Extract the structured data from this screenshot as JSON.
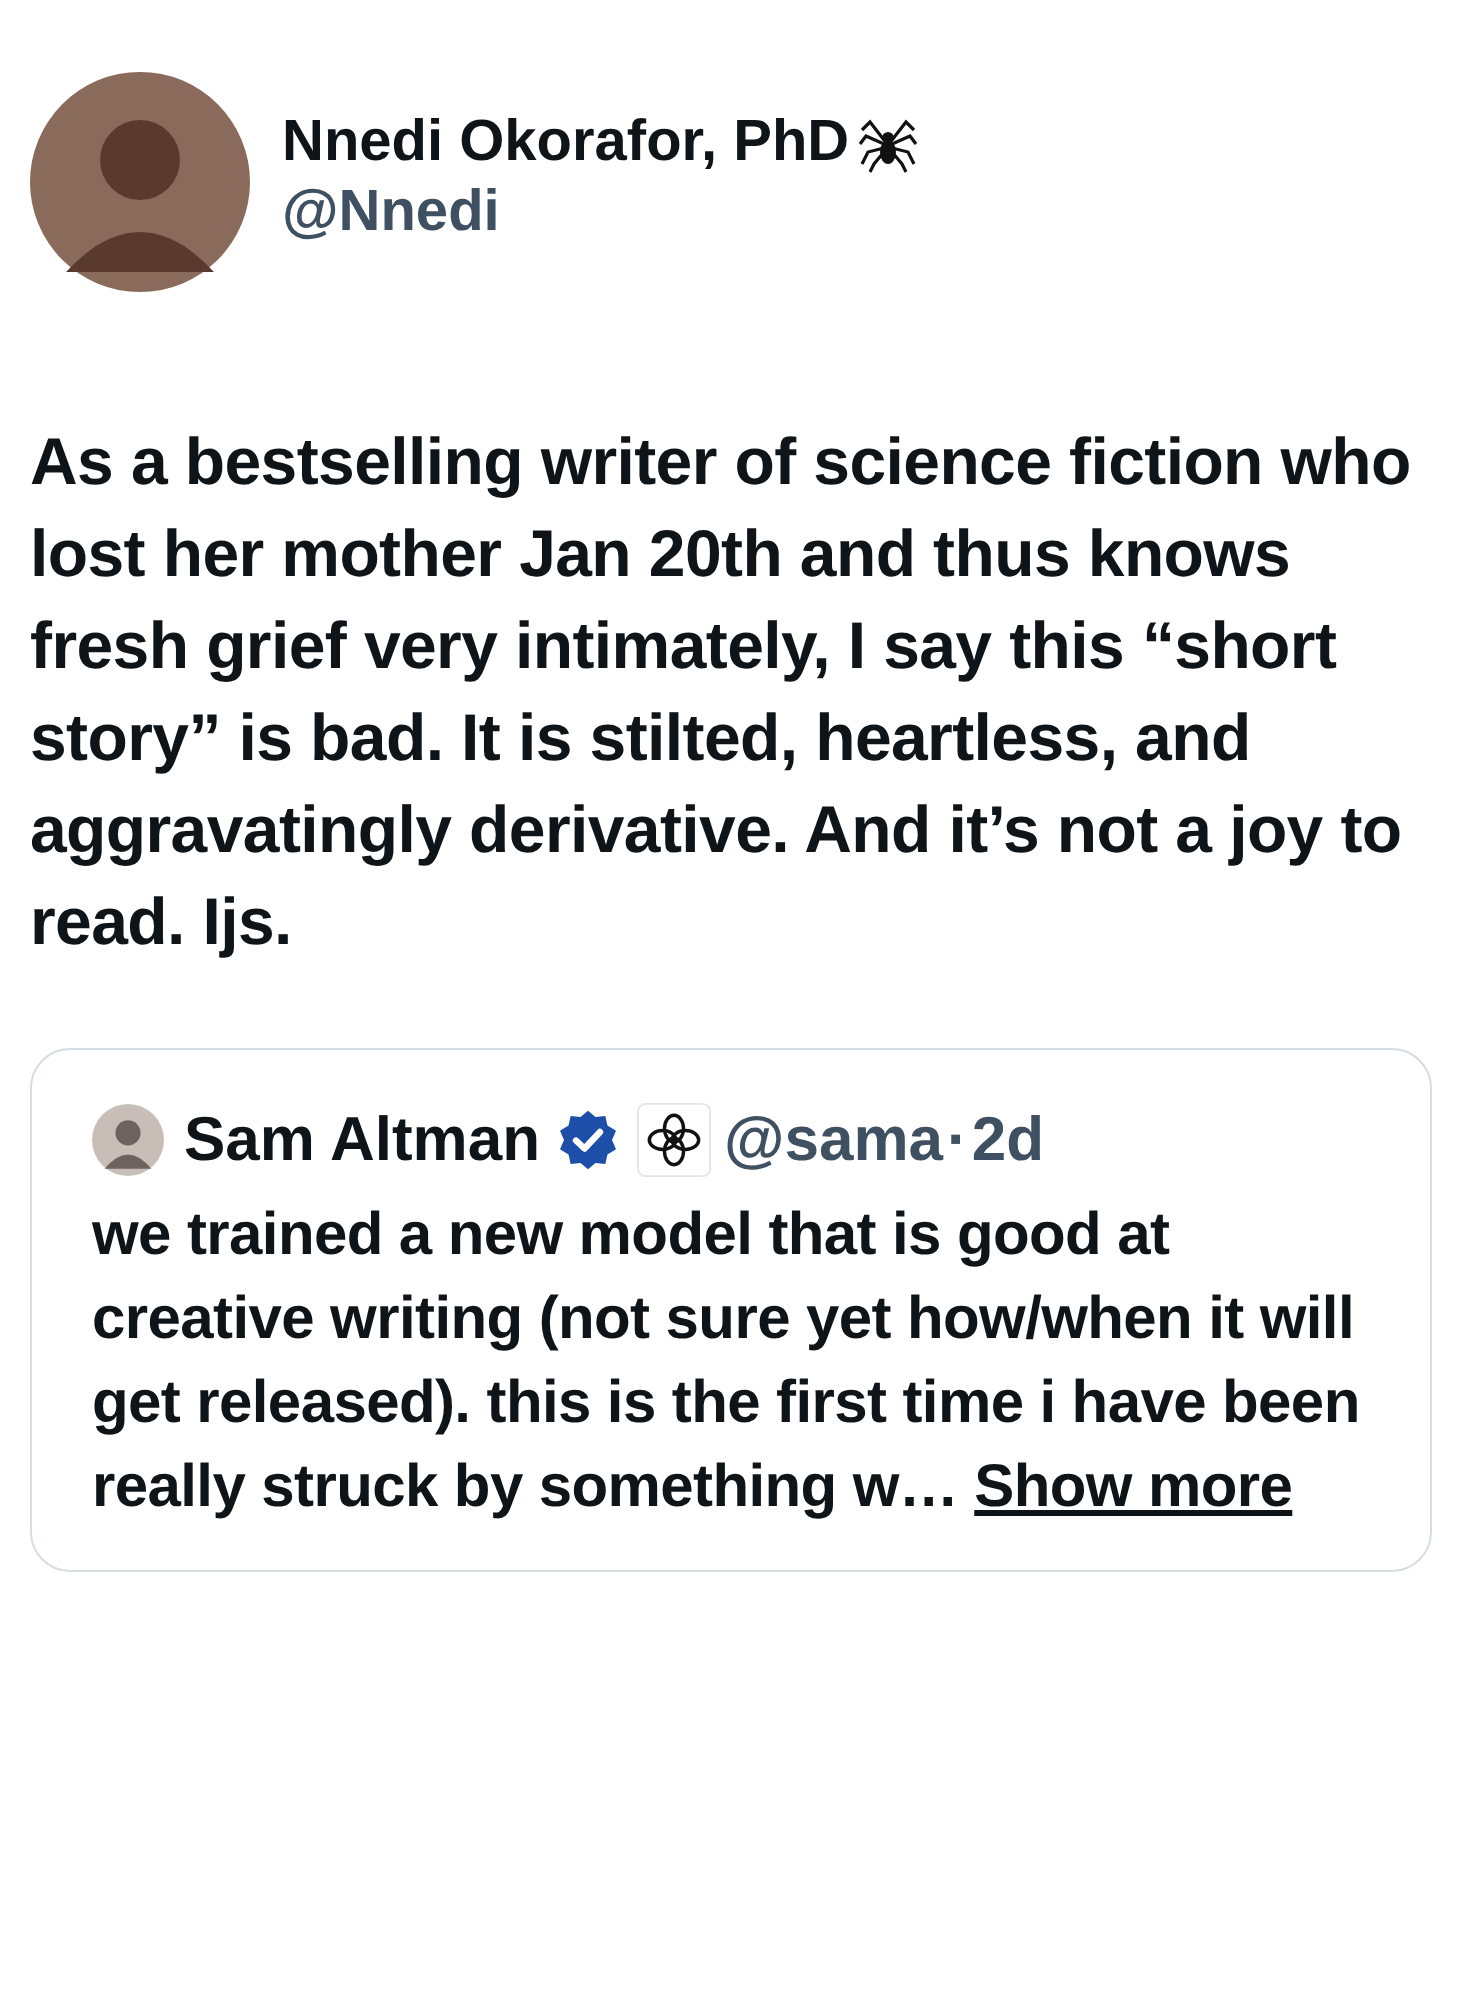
{
  "tweet": {
    "author": {
      "name": "Nnedi Okorafor, PhD",
      "handle": "@Nnedi"
    },
    "text": "As a bestselling writer of science fiction who lost her mother Jan 20th and thus knows fresh grief very intimately, I say this “short story” is bad. It is stilted, heartless, and aggravatingly derivative. And it’s not a joy to read. Ijs."
  },
  "quoted_tweet": {
    "author": {
      "name": "Sam Altman",
      "verified": true,
      "handle": "@sama",
      "separator": "·",
      "time": "2d"
    },
    "text": "we trained a new model that is good at creative writing (not sure yet how/when it will get released). this is the first time i have been really struck by something w…",
    "show_more": "Show more"
  }
}
